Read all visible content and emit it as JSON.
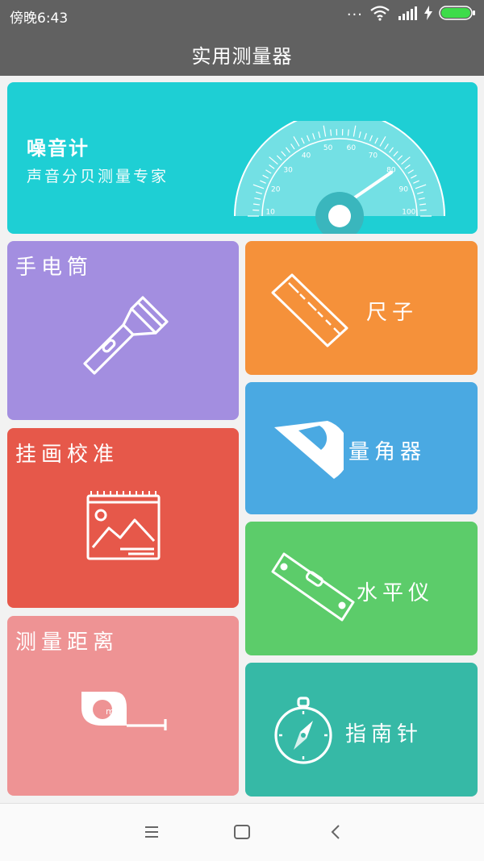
{
  "status": {
    "time": "傍晚6:43",
    "dots": "..."
  },
  "app": {
    "title": "实用测量器"
  },
  "noise": {
    "title": "噪音计",
    "subtitle": "声音分贝测量专家",
    "scale": [
      "10",
      "20",
      "30",
      "40",
      "50",
      "60",
      "70",
      "80",
      "90",
      "100"
    ]
  },
  "tiles": {
    "flashlight": "手电筒",
    "ruler": "尺子",
    "picture": "挂画校准",
    "protractor": "量角器",
    "level": "水平仪",
    "distance": "测量距离",
    "compass": "指南针"
  },
  "tape": {
    "unit": "m"
  },
  "colors": {
    "noise": "#1ecfd4",
    "flashlight": "#a38ee0",
    "ruler": "#f5913a",
    "picture": "#e6584a",
    "protractor": "#4aa9e2",
    "level": "#5ccc6a",
    "distance": "#ee9394",
    "compass": "#36b9a6"
  },
  "nav": {
    "menu": "menu-icon",
    "home": "home-icon",
    "back": "back-icon"
  }
}
